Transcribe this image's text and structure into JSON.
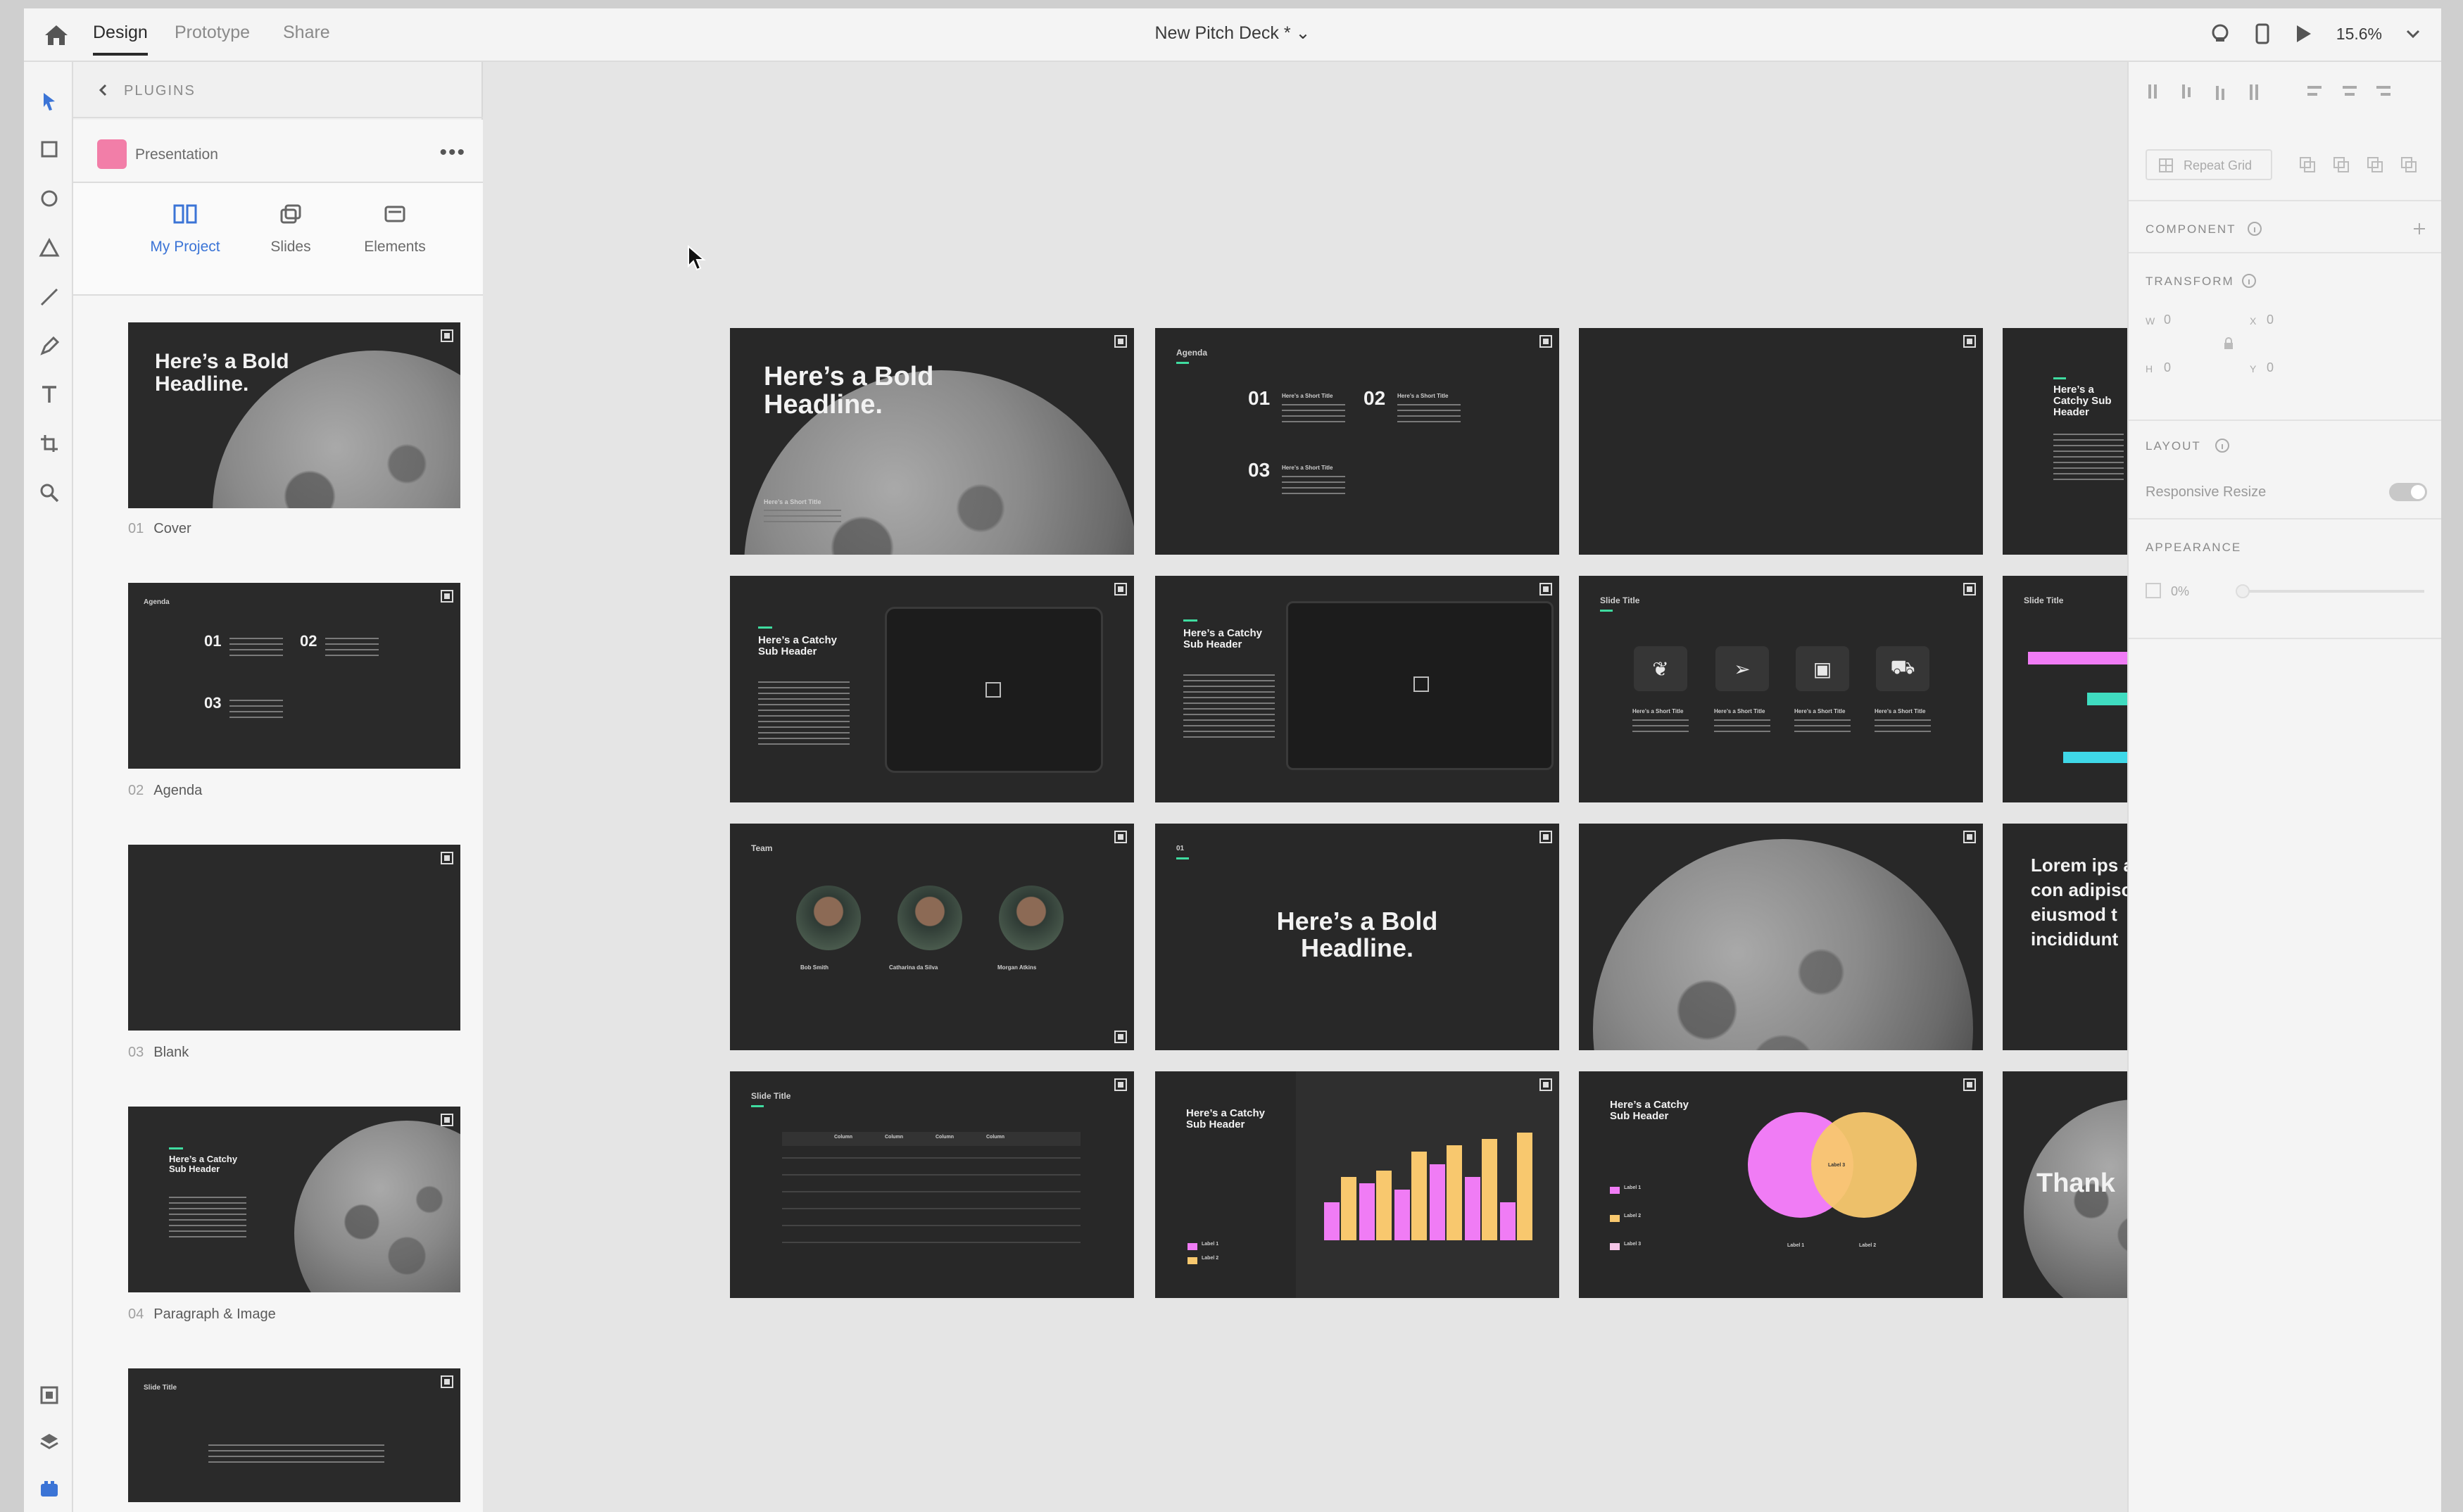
{
  "menu": {
    "design": "Design",
    "prototype": "Prototype",
    "share": "Share"
  },
  "document_title": "New Pitch Deck * ⌄",
  "zoom": "15.6%",
  "plugins": {
    "back_label": "PLUGINS",
    "plugin_name": "Presentation",
    "more": "•••",
    "tabs": [
      "My Project",
      "Slides",
      "Elements"
    ]
  },
  "templates": [
    {
      "num": "01",
      "name": "Cover"
    },
    {
      "num": "02",
      "name": "Agenda"
    },
    {
      "num": "03",
      "name": "Blank"
    },
    {
      "num": "04",
      "name": "Paragraph & Image"
    }
  ],
  "slides": {
    "headline": "Here’s a Bold Headline.",
    "short_title": "Here’s a Short Title",
    "agenda": "Agenda",
    "n01": "01",
    "n02": "02",
    "n03": "03",
    "catchy": "Here’s a Catchy Sub Header",
    "slide_title": "Slide Title",
    "team": "Team",
    "members": [
      "Bob Smith",
      "Catharina da Silva",
      "Morgan Atkins"
    ],
    "lorem": "Lorem ips amet, con adipiscing eiusmod t incididunt",
    "thank": "Thank",
    "label1": "Label 1",
    "label2": "Label 2",
    "label3": "Label 3",
    "column": "Column"
  },
  "chart_data": {
    "type": "bar",
    "series": [
      {
        "name": "Label 1",
        "color": "#f07cf5",
        "values": [
          30,
          45,
          40,
          60,
          50,
          30
        ]
      },
      {
        "name": "Label 2",
        "color": "#f8c86e",
        "values": [
          50,
          55,
          70,
          75,
          80,
          85
        ]
      }
    ]
  },
  "inspector": {
    "repeat_grid": "Repeat Grid",
    "component": "COMPONENT",
    "transform": "TRANSFORM",
    "w": "W",
    "w_val": "0",
    "x": "X",
    "x_val": "0",
    "h": "H",
    "h_val": "0",
    "y": "Y",
    "y_val": "0",
    "layout": "LAYOUT",
    "responsive": "Responsive Resize",
    "appearance": "APPEARANCE",
    "opacity": "0%"
  }
}
